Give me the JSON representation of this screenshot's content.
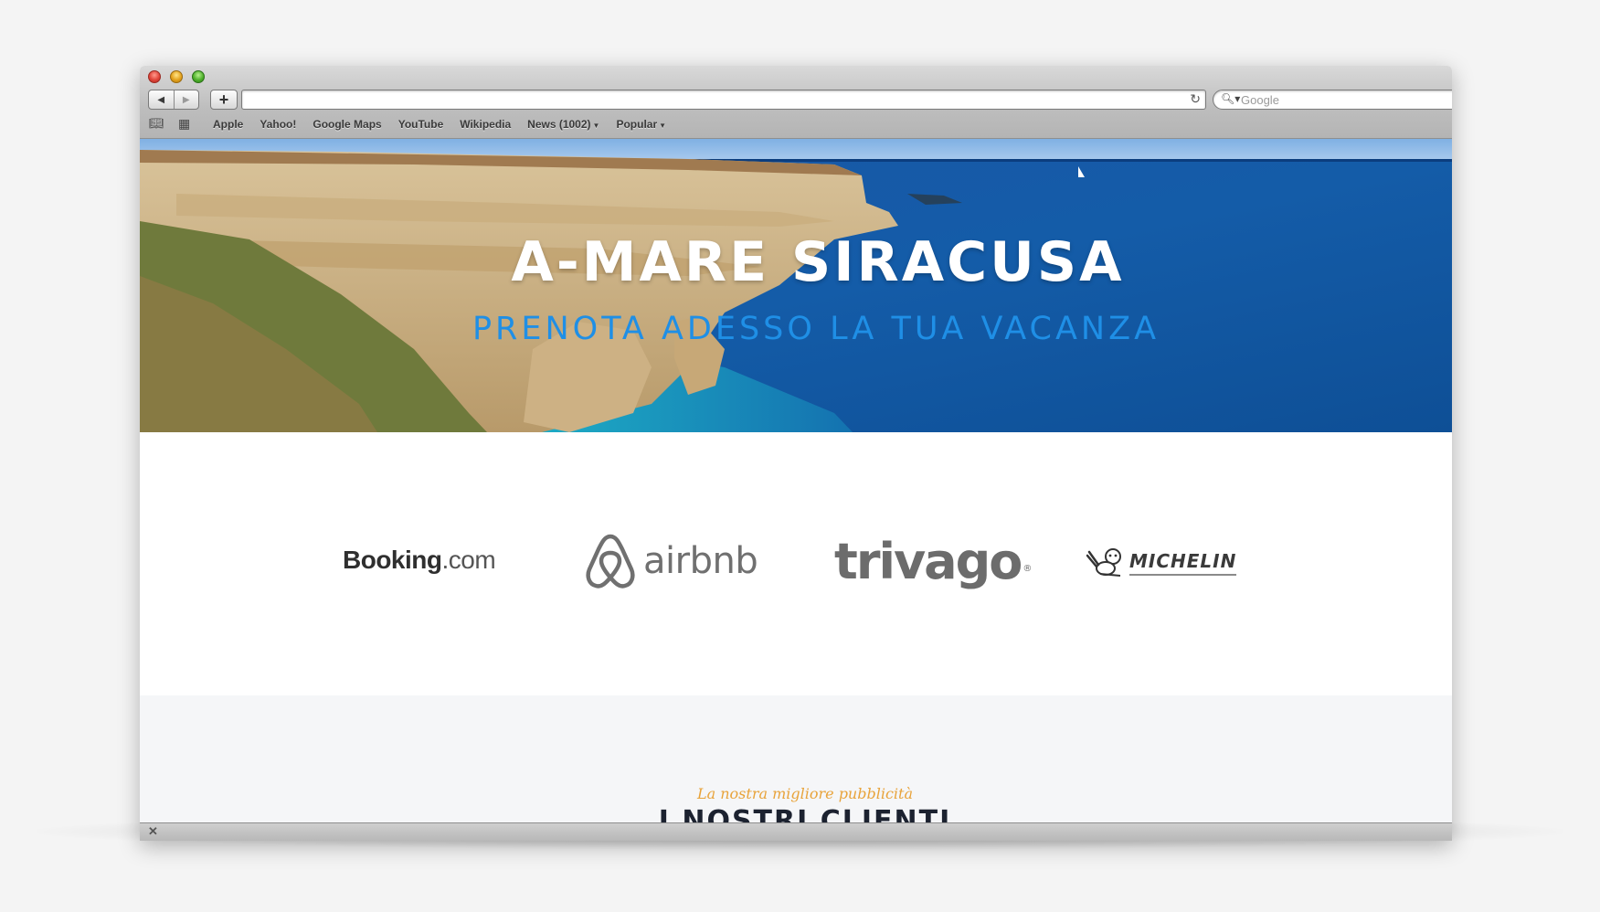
{
  "browser": {
    "search_placeholder": "Google",
    "bookmarks": [
      {
        "label": "Apple"
      },
      {
        "label": "Yahoo!"
      },
      {
        "label": "Google Maps"
      },
      {
        "label": "YouTube"
      },
      {
        "label": "Wikipedia"
      },
      {
        "label": "News (1002)",
        "dropdown": true
      },
      {
        "label": "Popular",
        "dropdown": true
      }
    ],
    "icons": {
      "back": "back-arrow-icon",
      "forward": "forward-arrow-icon",
      "add": "plus-icon",
      "reload": "reload-icon",
      "search": "search-icon",
      "reading_list": "book-icon",
      "top_sites": "grid-icon",
      "close": "close-icon"
    }
  },
  "hero": {
    "title": "A-MARE SIRACUSA",
    "subtitle": "PRENOTA ADESSO LA TUA VACANZA"
  },
  "partners": {
    "booking": {
      "name": "Booking",
      "suffix": ".com"
    },
    "airbnb": {
      "name": "airbnb"
    },
    "trivago": {
      "name": "trivago",
      "mark": "®"
    },
    "michelin": {
      "name": "MICHELIN"
    }
  },
  "clients": {
    "tagline": "La nostra migliore pubblicità",
    "title": "I NOSTRI CLIENTI"
  },
  "colors": {
    "sea": "#1a5fa8",
    "subtitle": "#1f8fe6",
    "tagline": "#e8a33a"
  }
}
